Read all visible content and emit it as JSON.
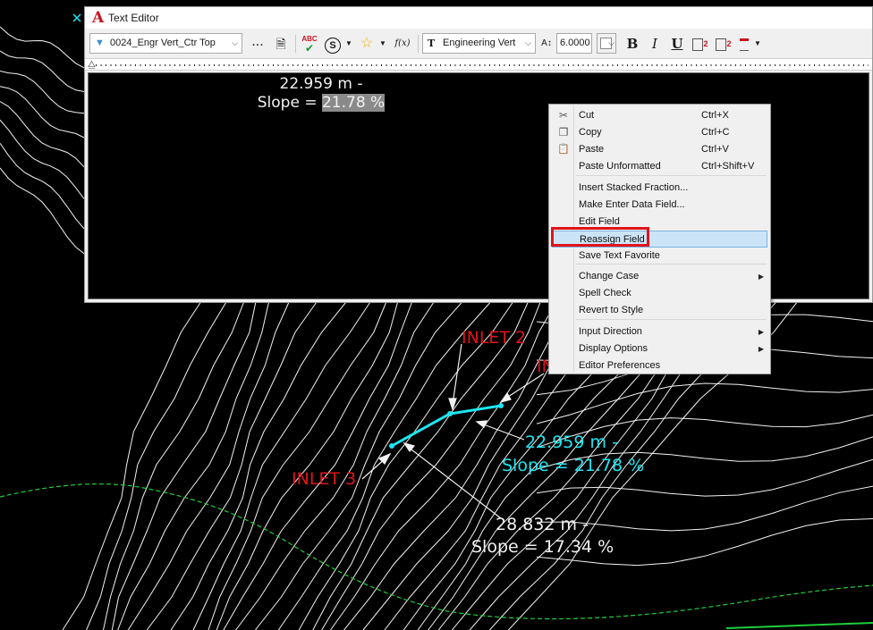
{
  "editor": {
    "title": "Text Editor",
    "title_icon": "autocad-a-icon",
    "toolbar": {
      "text_style": "0024_Engr Vert_Ctr Top",
      "text_style_icon": "text-style-icon",
      "more_label": "...",
      "font": "Engineering Vert",
      "font_icon": "truetype-font-icon",
      "height": "6.0000",
      "spell_label": "ABC",
      "stack_label": "S",
      "field_label": "f(x)",
      "bold": "B",
      "italic": "I",
      "underline": "U",
      "subscript_digit": "2",
      "superscript_digit": "2"
    },
    "content": {
      "line1": "22.959 m -",
      "line2_prefix": "Slope = ",
      "line2_selected": "21.78 %"
    }
  },
  "context_menu": {
    "items": [
      {
        "label": "Cut",
        "shortcut": "Ctrl+X",
        "icon": "scissors-icon"
      },
      {
        "label": "Copy",
        "shortcut": "Ctrl+C",
        "icon": "copy-icon"
      },
      {
        "label": "Paste",
        "shortcut": "Ctrl+V",
        "icon": "paste-icon"
      },
      {
        "label": "Paste Unformatted",
        "shortcut": "Ctrl+Shift+V"
      },
      {
        "label": "Insert Stacked Fraction..."
      },
      {
        "label": "Make Enter Data Field..."
      },
      {
        "label": "Edit Field"
      },
      {
        "label": "Reassign Field",
        "highlighted": true
      },
      {
        "label": "Save Text Favorite"
      },
      {
        "label": "Change Case",
        "submenu": true
      },
      {
        "label": "Spell Check"
      },
      {
        "label": "Revert to Style"
      },
      {
        "label": "Input Direction",
        "submenu": true
      },
      {
        "label": "Display Options",
        "submenu": true
      },
      {
        "label": "Editor Preferences"
      }
    ]
  },
  "drawing": {
    "labels": {
      "inlet2": "INLET 2",
      "inlet3": "INLET 3",
      "inlet_partial": "IN",
      "seg1_len": "22.959 m -",
      "seg1_slope": "Slope = 21.78 %",
      "seg2_len": "28.832 m -",
      "seg2_slope": "Slope = 17.34 %"
    }
  },
  "colors": {
    "background": "#000000",
    "contour": "#f2f2f2",
    "pipe": "#1ee6f2",
    "inlet_label": "#e0141a",
    "boundary_dashed": "#1fcf3a",
    "menu_highlight": "#cce4f7",
    "callout": "#e0141a"
  }
}
